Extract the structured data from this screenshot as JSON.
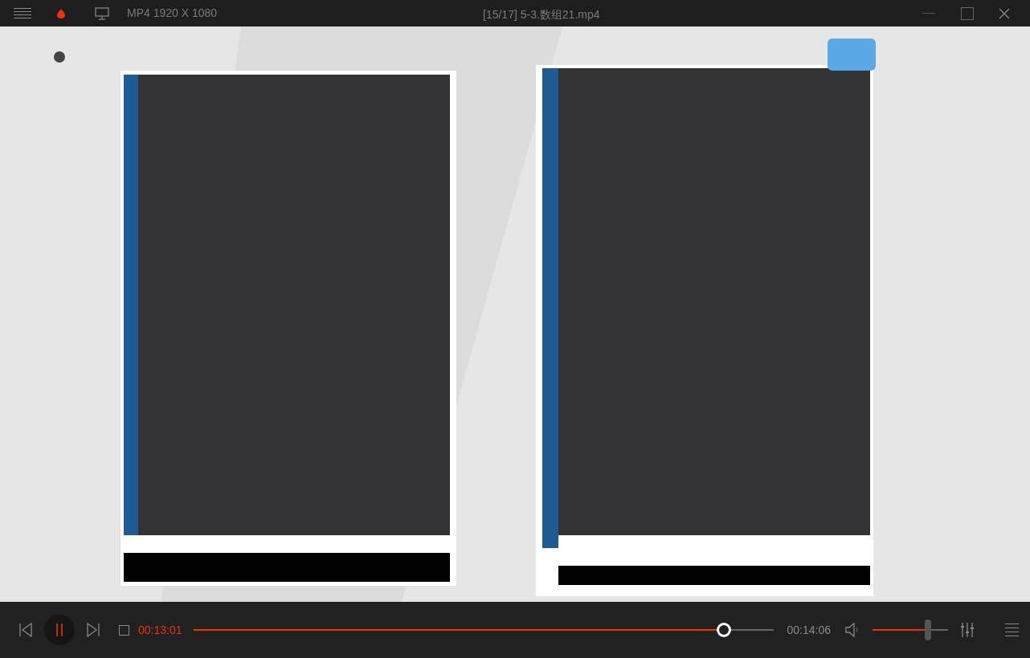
{
  "title_bar": {
    "format": "MP4 1920 X 1080",
    "title": "[15/17] 5-3.数组21.mp4"
  },
  "controls": {
    "playing": true,
    "current_time": "00:13:01",
    "progress": {
      "level": 0.915
    },
    "total_time": "00:14:06",
    "volume": {
      "level": 0.73
    }
  }
}
